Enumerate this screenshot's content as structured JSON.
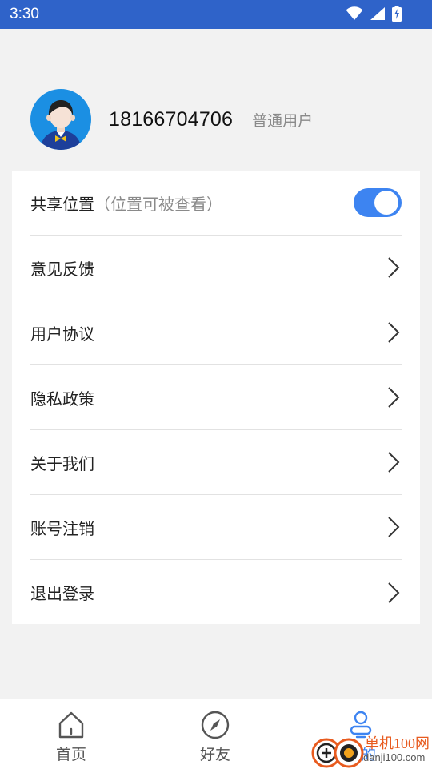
{
  "status_bar": {
    "time": "3:30"
  },
  "profile": {
    "phone": "18166704706",
    "user_type": "普通用户"
  },
  "menu": {
    "share_location": {
      "label": "共享位置",
      "sub": "（位置可被查看）",
      "enabled": true
    },
    "items": [
      {
        "label": "意见反馈"
      },
      {
        "label": "用户协议"
      },
      {
        "label": "隐私政策"
      },
      {
        "label": "关于我们"
      },
      {
        "label": "账号注销"
      },
      {
        "label": "退出登录"
      }
    ]
  },
  "tabbar": {
    "tabs": [
      {
        "label": "首页"
      },
      {
        "label": "好友"
      },
      {
        "label": "我的"
      }
    ]
  },
  "watermark": {
    "text": "单机100网",
    "url": "danji100.com"
  },
  "colors": {
    "accent": "#3d84f1",
    "status_bar": "#2f63c9"
  }
}
